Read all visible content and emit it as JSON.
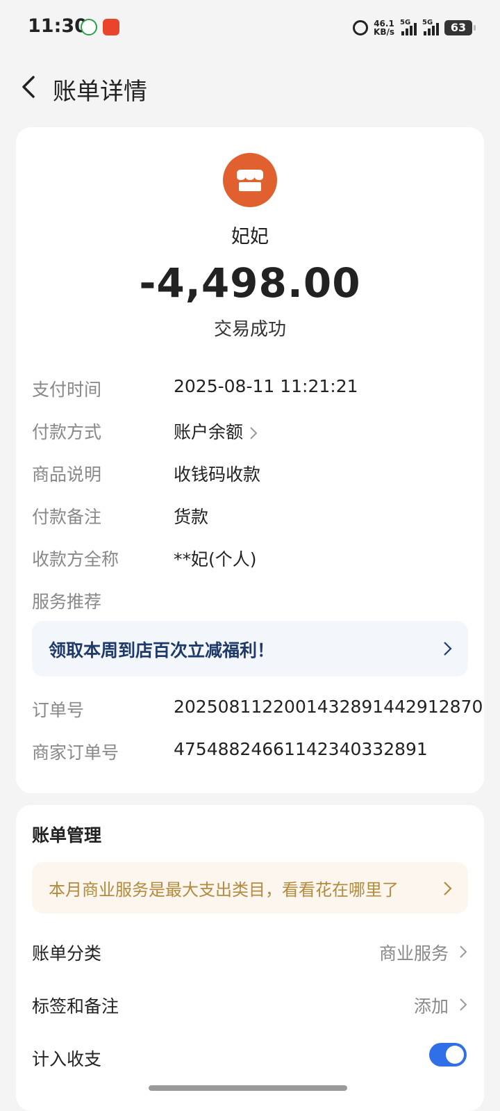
{
  "status_bar": {
    "time": "11:30",
    "speed_value": "46.1",
    "speed_unit": "KB/s",
    "net1": "5G",
    "net2": "5G",
    "battery": "63",
    "icons": [
      "app-icon-1",
      "taobao-app-icon",
      "alarm-icon",
      "signal-icon",
      "battery-icon"
    ]
  },
  "header": {
    "title": "账单详情",
    "back_icon": "chevron-left-icon"
  },
  "transaction": {
    "merchant_name": "妃妃",
    "amount": "-4,498.00",
    "status": "交易成功",
    "avatar_icon": "store-icon",
    "avatar_color": "#e0602f"
  },
  "details": [
    {
      "label": "支付时间",
      "value": "2025-08-11 11:21:21"
    },
    {
      "label": "付款方式",
      "value": "账户余额"
    },
    {
      "label": "商品说明",
      "value": "收钱码收款"
    },
    {
      "label": "付款备注",
      "value": "货款"
    },
    {
      "label": "收款方全称",
      "value": "**妃(个人)"
    },
    {
      "label": "服务推荐",
      "value": ""
    }
  ],
  "promo": {
    "text": "领取本周到店百次立减福利！"
  },
  "orders": [
    {
      "label": "订单号",
      "value": "2025081122001432891442912870"
    },
    {
      "label": "商家订单号",
      "value": "47548824661142340332891"
    }
  ],
  "management": {
    "title": "账单管理",
    "tip": "本月商业服务是最大支出类目，看看花在哪里了",
    "category_label": "账单分类",
    "category_value": "商业服务",
    "tags_label": "标签和备注",
    "tags_value": "添加",
    "include_label": "计入收支",
    "include_enabled": true
  },
  "colors": {
    "accent_blue": "#2f6fe8",
    "promo_text": "#1e3a6a",
    "tip_text": "#b48a3c",
    "avatar": "#e0602f"
  }
}
